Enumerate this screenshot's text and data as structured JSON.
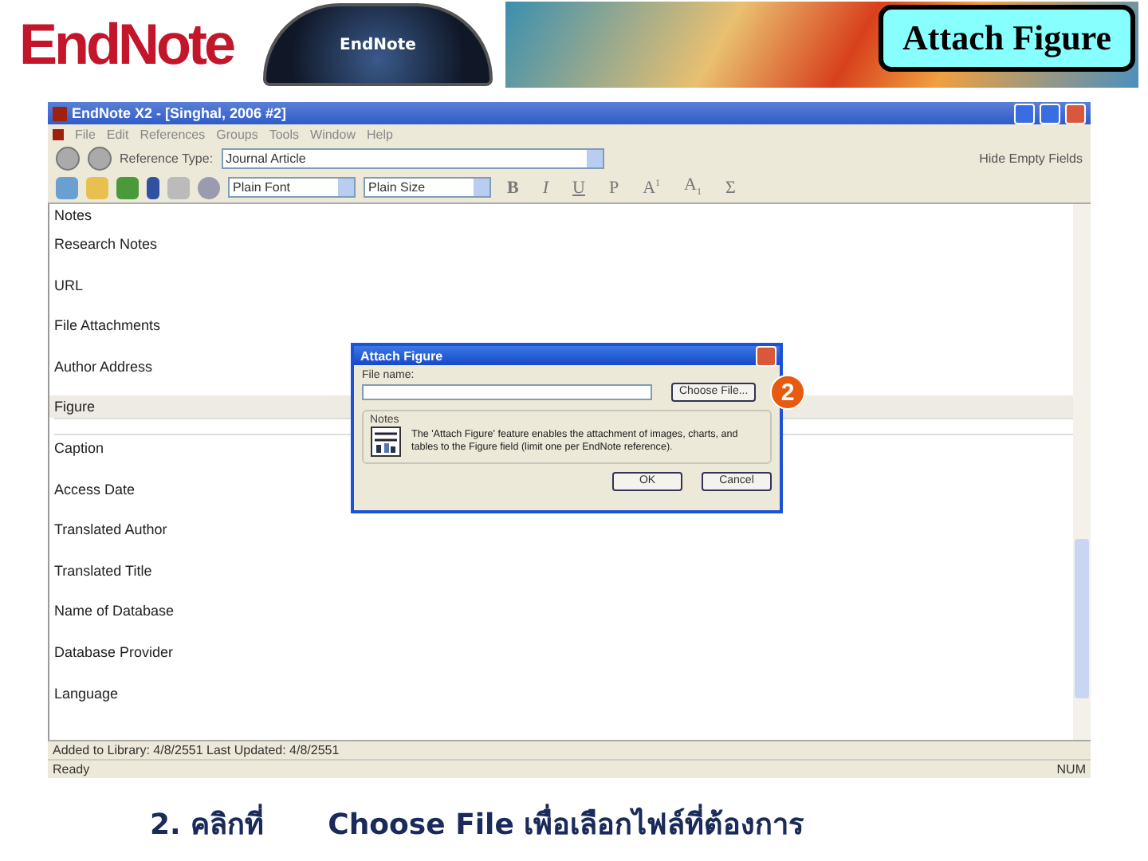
{
  "header": {
    "logo": "EndNote",
    "dial_label": "EndNote",
    "title": "Attach Figure"
  },
  "window": {
    "title": "EndNote X2 - [Singhal, 2006 #2]",
    "menu": [
      "File",
      "Edit",
      "References",
      "Groups",
      "Tools",
      "Window",
      "Help"
    ],
    "reference_type_label": "Reference Type:",
    "reference_type": "Journal Article",
    "hide_empty": "Hide Empty Fields",
    "font": "Plain Font",
    "size": "Plain Size",
    "format_buttons": [
      {
        "kind": "bold",
        "label": "B"
      },
      {
        "kind": "italic",
        "label": "I"
      },
      {
        "kind": "underline",
        "label": "U"
      },
      {
        "kind": "plain",
        "label": "P"
      },
      {
        "kind": "super",
        "label": "A",
        "mark": "1"
      },
      {
        "kind": "sub",
        "label": "A",
        "mark": "1"
      },
      {
        "kind": "plain",
        "label": "Σ"
      }
    ],
    "fields": [
      {
        "label": "Notes",
        "selected": false
      },
      {
        "label": "Research Notes",
        "selected": false
      },
      {
        "label": "URL",
        "selected": false
      },
      {
        "label": "File Attachments",
        "selected": false
      },
      {
        "label": "Author Address",
        "selected": false
      },
      {
        "label": "Figure",
        "selected": true
      },
      {
        "label": "Caption",
        "selected": false
      },
      {
        "label": "Access Date",
        "selected": false
      },
      {
        "label": "Translated Author",
        "selected": false
      },
      {
        "label": "Translated Title",
        "selected": false
      },
      {
        "label": "Name of Database",
        "selected": false
      },
      {
        "label": "Database Provider",
        "selected": false
      },
      {
        "label": "Language",
        "selected": false
      }
    ],
    "info_bar": "Added to Library: 4/8/2551    Last Updated: 4/8/2551",
    "status": {
      "left": "Ready",
      "right": "NUM"
    }
  },
  "dialog": {
    "title": "Attach Figure",
    "file_label": "File name:",
    "choose_button": "Choose File...",
    "group_label": "Notes",
    "note": "The 'Attach Figure' feature enables the attachment of images, charts, and tables to the Figure field (limit one per EndNote reference).",
    "buttons": [
      "OK",
      "Cancel"
    ],
    "step_badge": "2"
  },
  "caption": {
    "step": "2. คลิกที่",
    "text": "Choose File เพื่อเลือกไฟล์ที่ต้องการ"
  }
}
